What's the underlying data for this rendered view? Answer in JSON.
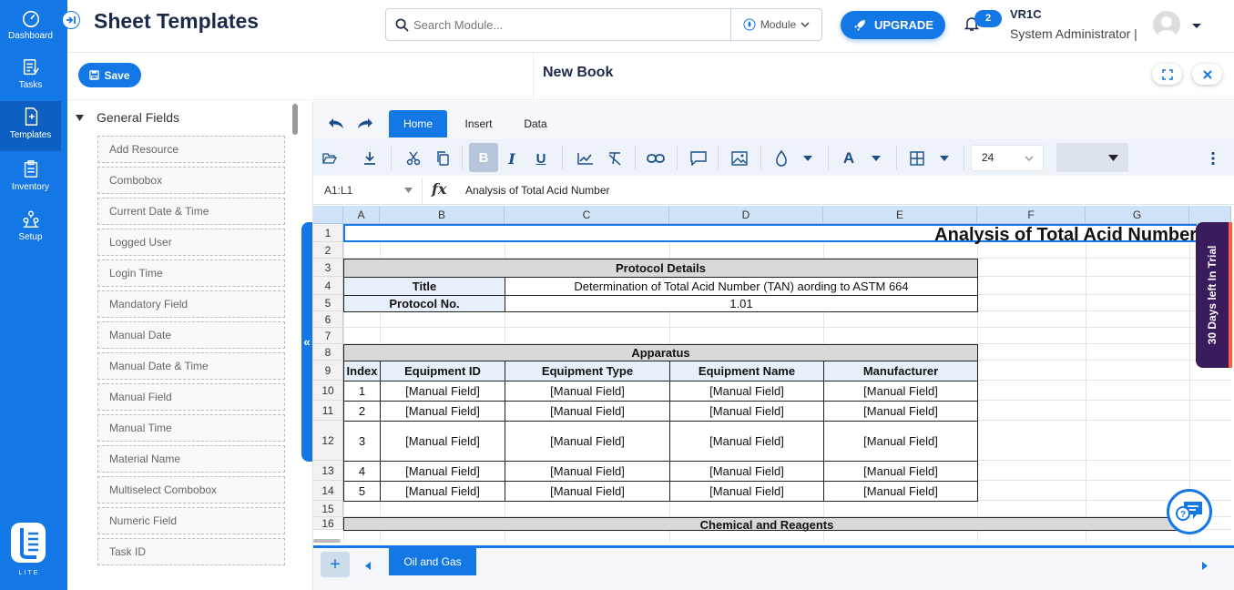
{
  "sidenav": {
    "items": [
      {
        "label": "Dashboard",
        "icon": "dashboard-gauge-icon"
      },
      {
        "label": "Tasks",
        "icon": "tasks-list-icon"
      },
      {
        "label": "Templates",
        "icon": "templates-doc-icon"
      },
      {
        "label": "Inventory",
        "icon": "inventory-clipboard-icon"
      },
      {
        "label": "Setup",
        "icon": "setup-network-icon"
      }
    ],
    "logo_text": "LITE"
  },
  "header": {
    "title": "Sheet Templates",
    "search_placeholder": "Search Module...",
    "module_label": "Module",
    "upgrade_label": "UPGRADE",
    "notification_count": "2",
    "user_name": "VR1C",
    "user_role": "System Administrator |"
  },
  "toolbar_top": {
    "save_label": "Save"
  },
  "book": {
    "title": "New Book"
  },
  "fields": {
    "group_label": "General Fields",
    "items": [
      "Add Resource",
      "Combobox",
      "Current Date & Time",
      "Logged User",
      "Login Time",
      "Mandatory Field",
      "Manual Date",
      "Manual Date & Time",
      "Manual Field",
      "Manual Time",
      "Material Name",
      "Multiselect Combobox",
      "Numeric Field",
      "Task ID"
    ]
  },
  "spreadsheet": {
    "tabs": [
      "Home",
      "Insert",
      "Data"
    ],
    "active_tab": "Home",
    "font_size": "24",
    "name_box": "A1:L1",
    "formula_value": "Analysis of Total Acid Number",
    "columns": [
      "A",
      "B",
      "C",
      "D",
      "E",
      "F",
      "G"
    ],
    "rows": [
      "1",
      "2",
      "3",
      "4",
      "5",
      "6",
      "7",
      "8",
      "9",
      "10",
      "11",
      "12",
      "13",
      "14",
      "15",
      "16"
    ],
    "title_cell": "Analysis of Total Acid Number",
    "protocol_header": "Protocol Details",
    "title_label": "Title",
    "title_value": "Determination of Total Acid Number (TAN) aording to ASTM 664",
    "protocol_no_label": "Protocol No.",
    "protocol_no_value": "1.01",
    "apparatus_header": "Apparatus",
    "apparatus_columns": [
      "Index",
      "Equipment ID",
      "Equipment Type",
      "Equipment Name",
      "Manufacturer"
    ],
    "apparatus_rows": [
      [
        "1",
        "[Manual Field]",
        "[Manual Field]",
        "[Manual Field]",
        "[Manual Field]"
      ],
      [
        "2",
        "[Manual Field]",
        "[Manual Field]",
        "[Manual Field]",
        "[Manual Field]"
      ],
      [
        "3",
        "[Manual Field]",
        "[Manual Field]",
        "[Manual Field]",
        "[Manual Field]"
      ],
      [
        "4",
        "[Manual Field]",
        "[Manual Field]",
        "[Manual Field]",
        "[Manual Field]"
      ],
      [
        "5",
        "[Manual Field]",
        "[Manual Field]",
        "[Manual Field]",
        "[Manual Field]"
      ]
    ],
    "chemicals_header": "Chemical and Reagents",
    "sheet_tab": "Oil and Gas"
  },
  "trial_banner": "30 Days left In Trial",
  "colors": {
    "accent": "#1477e6",
    "trial_bg": "#3a1b5b",
    "trial_edge": "#ff5e3a"
  }
}
